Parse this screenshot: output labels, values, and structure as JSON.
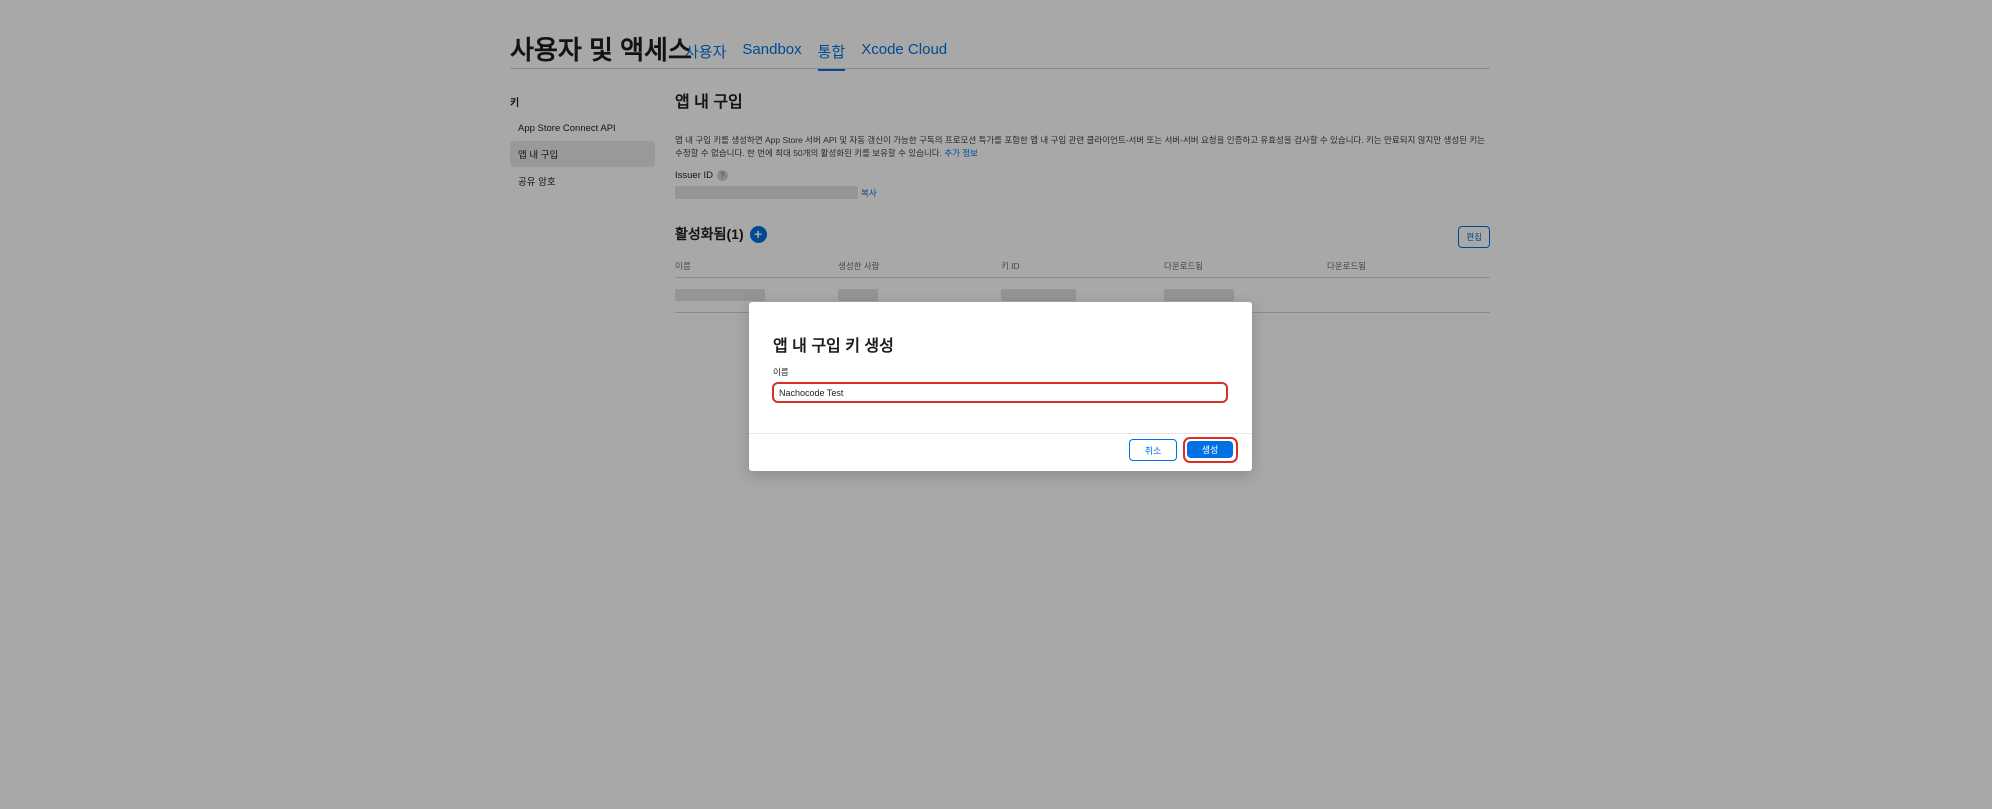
{
  "header": {
    "title": "사용자 및 액세스",
    "tabs": [
      {
        "label": "사용자",
        "active": false
      },
      {
        "label": "Sandbox",
        "active": false
      },
      {
        "label": "통합",
        "active": true
      },
      {
        "label": "Xcode Cloud",
        "active": false
      }
    ]
  },
  "sidebar": {
    "heading": "키",
    "items": [
      {
        "label": "App Store Connect API",
        "active": false
      },
      {
        "label": "앱 내 구입",
        "active": true
      },
      {
        "label": "공유 암호",
        "active": false
      }
    ]
  },
  "main": {
    "section_title": "앱 내 구입",
    "description": "앱 내 구입 키를 생성하면 App Store 서버 API 및 자동 갱신이 가능한 구독의 프로모션 특가를 포함한 앱 내 구입 관련 클라이언트-서버 또는 서버-서버 요청을 인증하고 유효성을 검사할 수 있습니다. 키는 만료되지 않지만 생성된 키는 수정할 수 없습니다. 한 번에 최대 50개의 활성화된 키를 보유할 수 있습니다.",
    "more_info_link": "추가 정보",
    "issuer_label": "Issuer ID",
    "help_icon": "?",
    "copy_label": "복사",
    "active_title": "활성화됨(1)",
    "add_icon": "+",
    "edit_label": "편집",
    "columns": [
      "이름",
      "생성한 사람",
      "키 ID",
      "다운로드됨",
      "다운로드됨"
    ]
  },
  "modal": {
    "title": "앱 내 구입 키 생성",
    "name_label": "이름",
    "name_value": "Nachocode Test",
    "cancel_label": "취소",
    "create_label": "생성"
  },
  "colors": {
    "accent": "#0071e3",
    "highlight": "#d93025",
    "overlay": "rgba(0,0,0,0.34)"
  }
}
